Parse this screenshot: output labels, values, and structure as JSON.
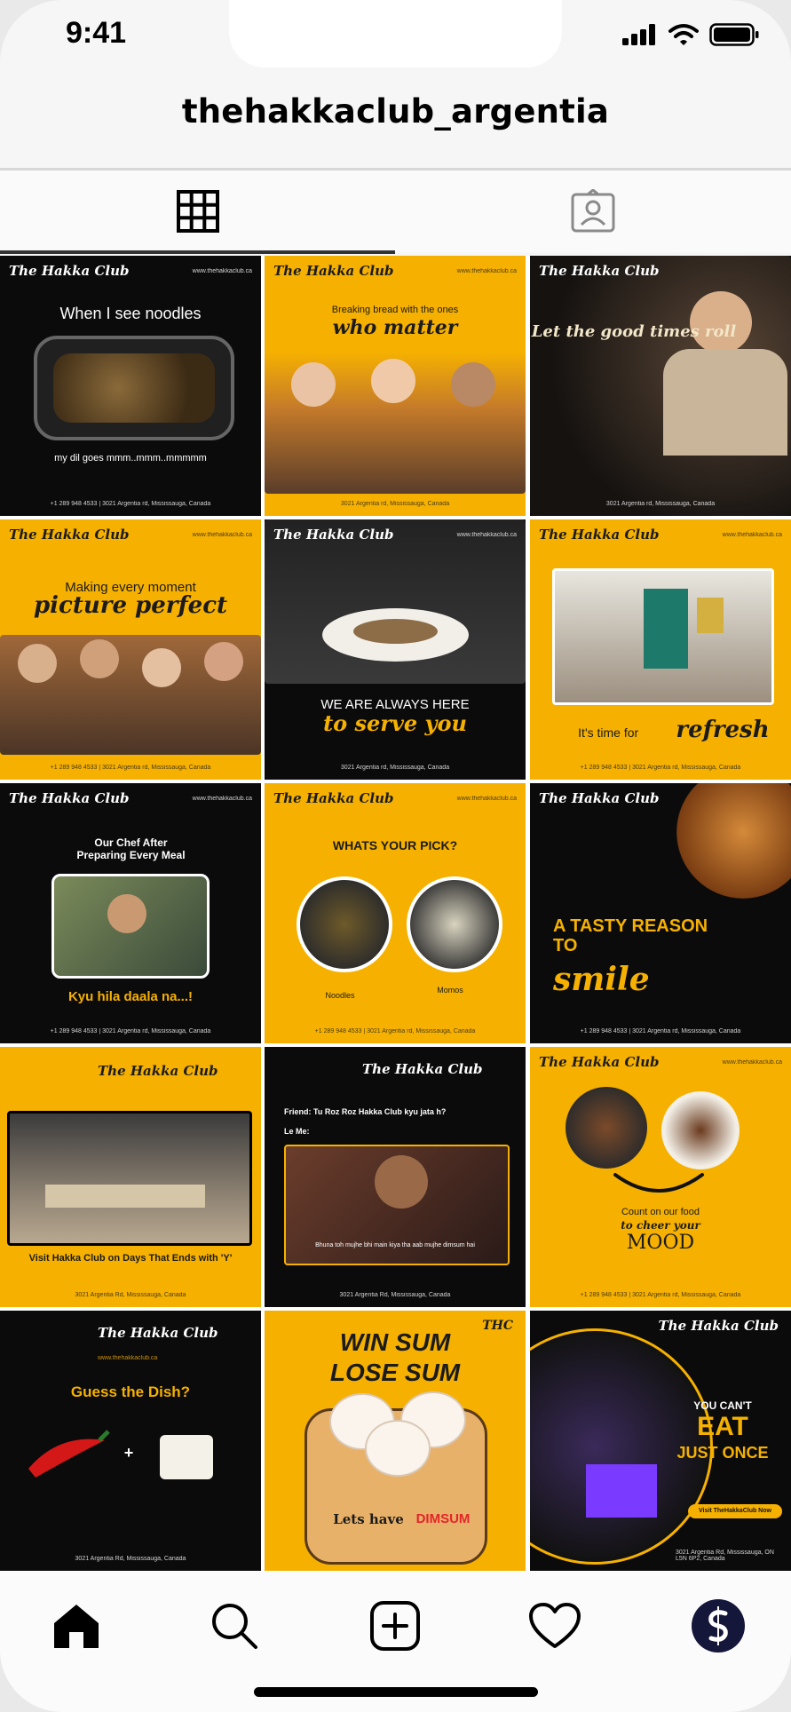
{
  "status": {
    "time": "9:41"
  },
  "header": {
    "username": "thehakkaclub_argentia"
  },
  "tabs": [
    {
      "icon": "grid-icon"
    },
    {
      "icon": "tagged-icon"
    }
  ],
  "colors": {
    "accent": "#f6b100",
    "dark": "#0b0b0b"
  },
  "posts": [
    {
      "logo": "The Hakka Club",
      "site": "www.thehakkaclub.ca",
      "title": "When I see noodles",
      "caption": "my dil goes mmm..mmm..mmmmm",
      "footer": "+1 289 948 4533  |  3021 Argentia rd, Mississauga, Canada"
    },
    {
      "logo": "The Hakka Club",
      "site": "www.thehakkaclub.ca",
      "title": "Breaking bread with the ones",
      "script": "who matter",
      "footer": "3021 Argentia rd, Mississauga, Canada"
    },
    {
      "logo": "The Hakka Club",
      "script": "Let the good times roll",
      "footer": "3021 Argentia rd, Mississauga, Canada"
    },
    {
      "logo": "The Hakka Club",
      "site": "www.thehakkaclub.ca",
      "title": "Making every moment",
      "script": "picture perfect",
      "footer": "+1 289 948 4533  |  3021 Argentia rd, Mississauga, Canada"
    },
    {
      "logo": "The Hakka Club",
      "site": "www.thehakkaclub.ca",
      "title": "WE ARE ALWAYS HERE",
      "script": "to serve you",
      "footer": "3021 Argentia rd, Mississauga, Canada"
    },
    {
      "logo": "The Hakka Club",
      "site": "www.thehakkaclub.ca",
      "title": "It's time for",
      "script": "refresh",
      "footer": "+1 289 948 4533  |  3021 Argentia rd, Mississauga, Canada"
    },
    {
      "logo": "The Hakka Club",
      "site": "www.thehakkaclub.ca",
      "title": "Our Chef After Preparing Every Meal",
      "caption": "Kyu hila daala na...!",
      "footer": "+1 289 948 4533  |  3021 Argentia rd, Mississauga, Canada"
    },
    {
      "logo": "The Hakka Club",
      "site": "www.thehakkaclub.ca",
      "title": "WHATS YOUR PICK?",
      "label_left": "Noodles",
      "label_right": "Momos",
      "footer": "+1 289 948 4533  |  3021 Argentia rd, Mississauga, Canada"
    },
    {
      "logo": "The Hakka Club",
      "title": "A TASTY REASON TO",
      "script": "smile",
      "footer": "+1 289 948 4533  |  3021 Argentia rd, Mississauga, Canada"
    },
    {
      "logo": "The Hakka Club",
      "caption": "Visit Hakka Club on Days That Ends with 'Y'",
      "footer": "3021 Argentia Rd, Mississauga, Canada"
    },
    {
      "logo": "The Hakka Club",
      "title": "Friend: Tu Roz Roz Hakka Club kyu jata h?",
      "title2": "Le Me:",
      "caption": "Bhuna toh mujhe bhi main kiya tha aab mujhe dimsum hai",
      "footer": "3021 Argentia Rd, Mississauga, Canada"
    },
    {
      "logo": "The Hakka Club",
      "site": "www.thehakkaclub.ca",
      "title": "Count on our food",
      "script": "to cheer your",
      "caption": "MOOD",
      "footer": "+1 289 948 4533  |  3021 Argentia rd, Mississauga, Canada"
    },
    {
      "logo": "The Hakka Club",
      "site": "www.thehakkaclub.ca",
      "title": "Guess the Dish?",
      "footer": "3021 Argentia Rd, Mississauga, Canada"
    },
    {
      "logo": "THC",
      "title": "WIN SUM",
      "title2": "LOSE SUM",
      "caption": "Lets have",
      "caption2": "DIMSUM"
    },
    {
      "logo": "The Hakka Club",
      "title": "YOU CAN'T",
      "title2": "EAT",
      "caption": "JUST ONCE",
      "button": "Visit TheHakkaClub Now",
      "footer": "3021 Argentia Rd, Mississauga, ON L5N 6P2, Canada"
    }
  ],
  "tabbar": [
    {
      "icon": "home-icon"
    },
    {
      "icon": "search-icon"
    },
    {
      "icon": "add-post-icon"
    },
    {
      "icon": "heart-icon"
    },
    {
      "icon": "profile-avatar"
    }
  ]
}
